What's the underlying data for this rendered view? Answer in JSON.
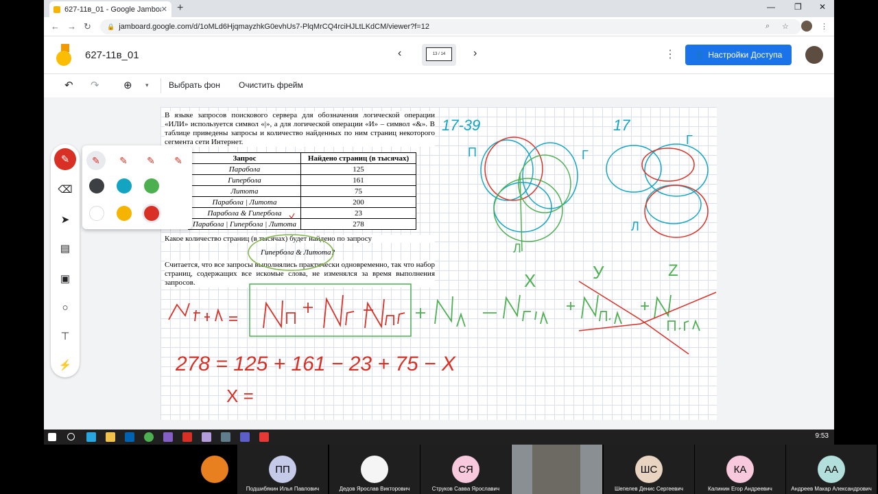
{
  "browser": {
    "tab_title": "627-11в_01 - Google Jamboard",
    "url": "jamboard.google.com/d/1oMLd6HjqmayzhkG0evhUs7-PlqMrCQ4rciHJLtLKdCM/viewer?f=12"
  },
  "jamboard": {
    "title": "627-11в_01",
    "frame_indicator": "13 / 14",
    "share_label": "Настройки Доступа",
    "toolbar": {
      "set_background": "Выбрать фон",
      "clear_frame": "Очистить фрейм"
    }
  },
  "problem": {
    "intro": "В языке запросов поискового сервера для обозначения логической операции «ИЛИ» используется символ «|», а для логической операции «И» – символ «&». В таблице приведены запросы и количество найденных по ним страниц некоторого сегмента сети Интернет.",
    "table": {
      "headers": [
        "Запрос",
        "Найдено страниц (в тысячах)"
      ],
      "rows": [
        [
          "Парабола",
          "125"
        ],
        [
          "Гипербола",
          "161"
        ],
        [
          "Литота",
          "75"
        ],
        [
          "Парабола | Литота",
          "200"
        ],
        [
          "Парабола & Гипербола",
          "23"
        ],
        [
          "Парабола | Гипербола | Литота",
          "278"
        ]
      ]
    },
    "question": "Какое количество страниц (в тысячах) будет найдено по запросу",
    "query": "Гипербола & Литота?",
    "note": "Считается, что все запросы выполнялись практически одновременно, так что набор страниц, содержащих все искомые слова, не изменялся за время выполнения запросов."
  },
  "handwriting": {
    "label_range": "17-39",
    "label_17": "17",
    "letter_p": "П",
    "letter_g1": "Г",
    "letter_l1": "Л",
    "letter_g2": "Г",
    "letter_l2": "Л",
    "var_x": "X",
    "var_y": "У",
    "var_z": "Z",
    "equation": "278 = 125 + 161 − 23 + 75 − X",
    "answer_start": "X ="
  },
  "taskbar": {
    "time": "9:53"
  },
  "participants": [
    {
      "initials": "",
      "name": "",
      "color": "#e8801f"
    },
    {
      "initials": "ПП",
      "name": "Подшибякин Илья Павлович",
      "color": "#c5cae9"
    },
    {
      "initials": "",
      "name": "Дедов Ярослав Викторович",
      "color": "#f5f5f5"
    },
    {
      "initials": "СЯ",
      "name": "Струков Савва Ярославич",
      "color": "#f8c8dc"
    },
    {
      "initials": "",
      "name": "",
      "color": "#555555"
    },
    {
      "initials": "ШС",
      "name": "Шепелев Денис Сергеевич",
      "color": "#e8d4c0"
    },
    {
      "initials": "КА",
      "name": "Калинин Егор Андреевич",
      "color": "#f8c8dc"
    },
    {
      "initials": "АА",
      "name": "Андреев Макар Александрович",
      "color": "#b2dfdb"
    }
  ],
  "colors": {
    "accent_blue": "#1a73e8",
    "pen_red": "#d93025",
    "ink_green": "#4caf50",
    "ink_teal": "#12a4c0"
  }
}
